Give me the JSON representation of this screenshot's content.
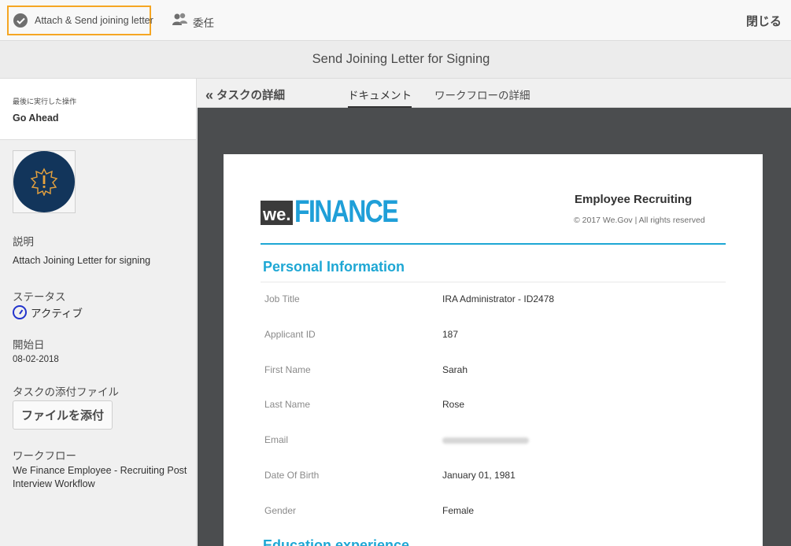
{
  "toolbar": {
    "attach_send_label": "Attach & Send joining letter",
    "delegate_label": "委任",
    "close_label": "閉じる"
  },
  "title": "Send Joining Letter for Signing",
  "left_panel": {
    "last_action_caption": "最後に実行した操作",
    "last_action_value": "Go Ahead",
    "description_label": "説明",
    "description_value": "Attach Joining Letter for signing",
    "status_label": "ステータス",
    "status_value": "アクティブ",
    "start_date_label": "開始日",
    "start_date_value": "08-02-2018",
    "attachments_label": "タスクの添付ファイル",
    "attach_file_button": "ファイルを添付",
    "workflow_label": "ワークフロー",
    "workflow_value": "We Finance Employee - Recruiting Post Interview Workflow"
  },
  "tabs": {
    "back_label": "タスクの詳細",
    "items": [
      {
        "label": "ドキュメント",
        "active": true
      },
      {
        "label": "ワークフローの詳細",
        "active": false
      }
    ]
  },
  "document": {
    "logo_we": "we.",
    "logo_finance": "FINANCE",
    "header_title": "Employee Recruiting",
    "copyright": "© 2017 We.Gov | All rights reserved",
    "section1": "Personal Information",
    "section2": "Education experience",
    "rows": [
      {
        "label": "Job Title",
        "value": "IRA Administrator - ID2478"
      },
      {
        "label": "Applicant ID",
        "value": "187"
      },
      {
        "label": "First Name",
        "value": "Sarah"
      },
      {
        "label": "Last Name",
        "value": "Rose"
      },
      {
        "label": "Email",
        "value": ""
      },
      {
        "label": "Date Of Birth",
        "value": "January 01, 1981"
      },
      {
        "label": "Gender",
        "value": "Female"
      }
    ]
  },
  "colors": {
    "accent_blue": "#1ea7d4",
    "highlight_orange": "#f5a623",
    "avatar_navy": "#12355b",
    "status_blue": "#2233cc"
  }
}
